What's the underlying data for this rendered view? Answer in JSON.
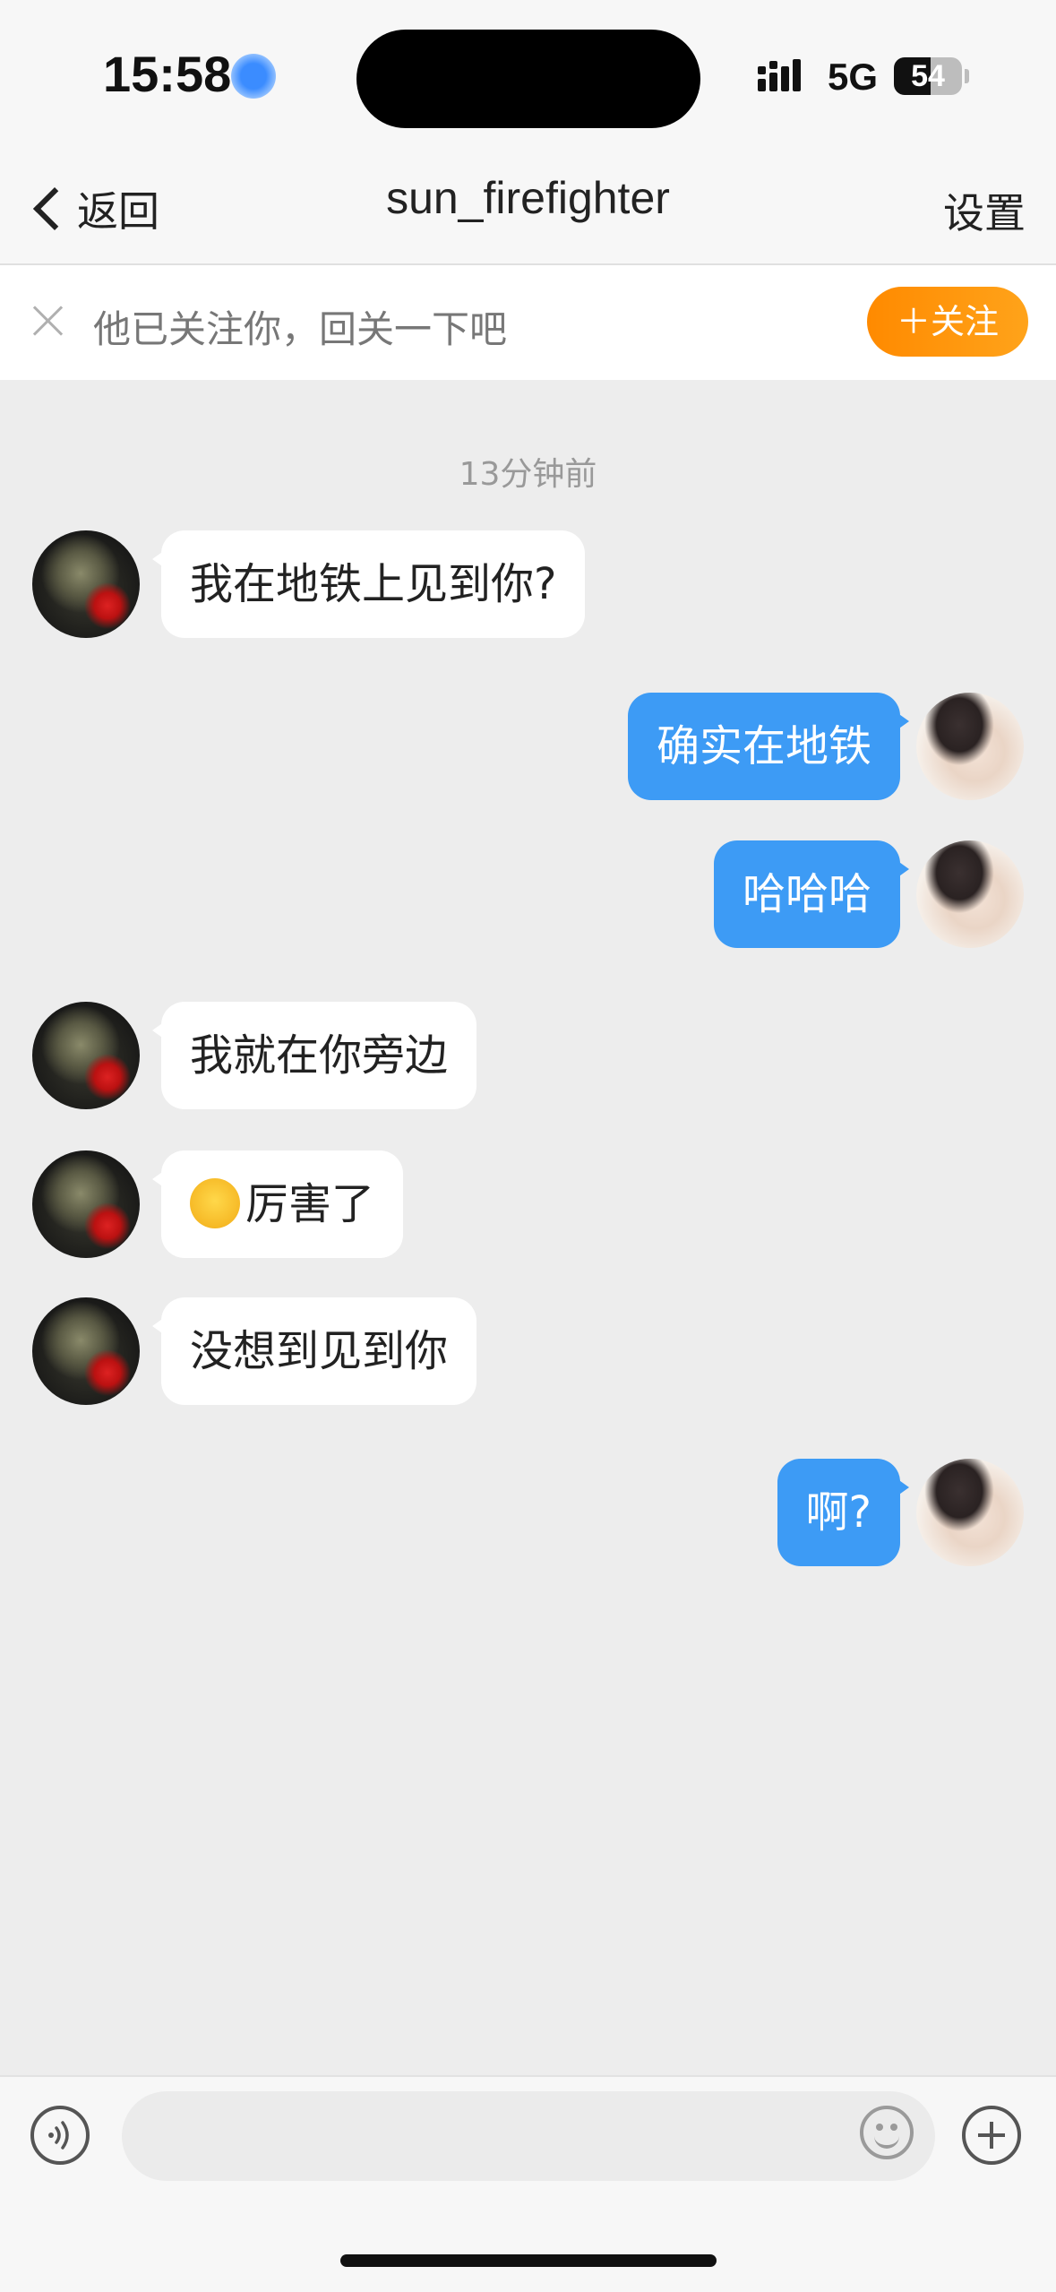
{
  "status_bar": {
    "time": "15:58",
    "network": "5G",
    "battery": "54",
    "battery_level": 0.54
  },
  "nav": {
    "back_label": "返回",
    "title": "sun_firefighter",
    "settings_label": "设置"
  },
  "follow_banner": {
    "text": "他已关注你，回关一下吧",
    "follow_label": "＋关注"
  },
  "chat": {
    "timestamp": "13分钟前",
    "messages": [
      {
        "sender": "other",
        "text": "我在地铁上见到你?"
      },
      {
        "sender": "me",
        "text": "确实在地铁"
      },
      {
        "sender": "me",
        "text": "哈哈哈"
      },
      {
        "sender": "other",
        "text": "我就在你旁边"
      },
      {
        "sender": "other",
        "emoji": "cry-laugh-icon",
        "text": "厉害了"
      },
      {
        "sender": "other",
        "text": "没想到见到你"
      },
      {
        "sender": "me",
        "text": "啊?"
      }
    ]
  },
  "colors": {
    "my_bubble": "#3d9bf5",
    "follow_button": "#ff8a00",
    "background": "#ededed"
  }
}
